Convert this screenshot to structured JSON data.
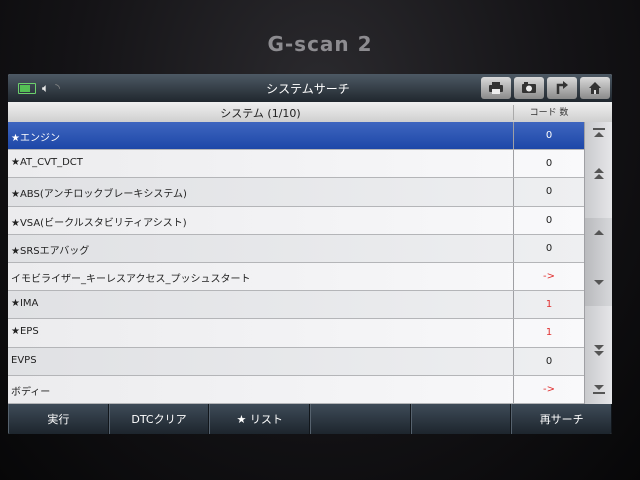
{
  "device": {
    "brand": "G-scan 2"
  },
  "titlebar": {
    "title": "システムサーチ",
    "icons": [
      "battery-icon",
      "speaker-icon",
      "wifi-icon"
    ],
    "buttons": [
      "printer-icon",
      "camera-icon",
      "back-icon",
      "home-icon"
    ]
  },
  "table": {
    "header_system": "システム (1/10)",
    "header_count": "コード 数",
    "rows": [
      {
        "name": "★エンジン",
        "count": "0",
        "selected": true
      },
      {
        "name": "★AT_CVT_DCT",
        "count": "0"
      },
      {
        "name": "★ABS(アンチロックブレーキシステム)",
        "count": "0"
      },
      {
        "name": "★VSA(ビークルスタビリティアシスト)",
        "count": "0"
      },
      {
        "name": "★SRSエアバッグ",
        "count": "0"
      },
      {
        "name": "イモビライザー_キーレスアクセス_プッシュスタート",
        "count": "->",
        "red": true
      },
      {
        "name": "★IMA",
        "count": "1",
        "red": true
      },
      {
        "name": "★EPS",
        "count": "1",
        "red": true
      },
      {
        "name": "EVPS",
        "count": "0"
      },
      {
        "name": "ボディー",
        "count": "->",
        "red": true
      }
    ]
  },
  "scrollbar": {
    "buttons": [
      "scroll-top-icon",
      "page-up-icon",
      "line-up-icon",
      "line-down-icon",
      "page-down-icon",
      "scroll-bottom-icon"
    ]
  },
  "bottombar": {
    "execute": "実行",
    "dtc_clear": "DTCクリア",
    "list": "★ リスト",
    "research": "再サーチ"
  },
  "colors": {
    "selected_row": "#2a52b3",
    "red_value": "#e03030",
    "bar_dark": "#2a343e"
  }
}
